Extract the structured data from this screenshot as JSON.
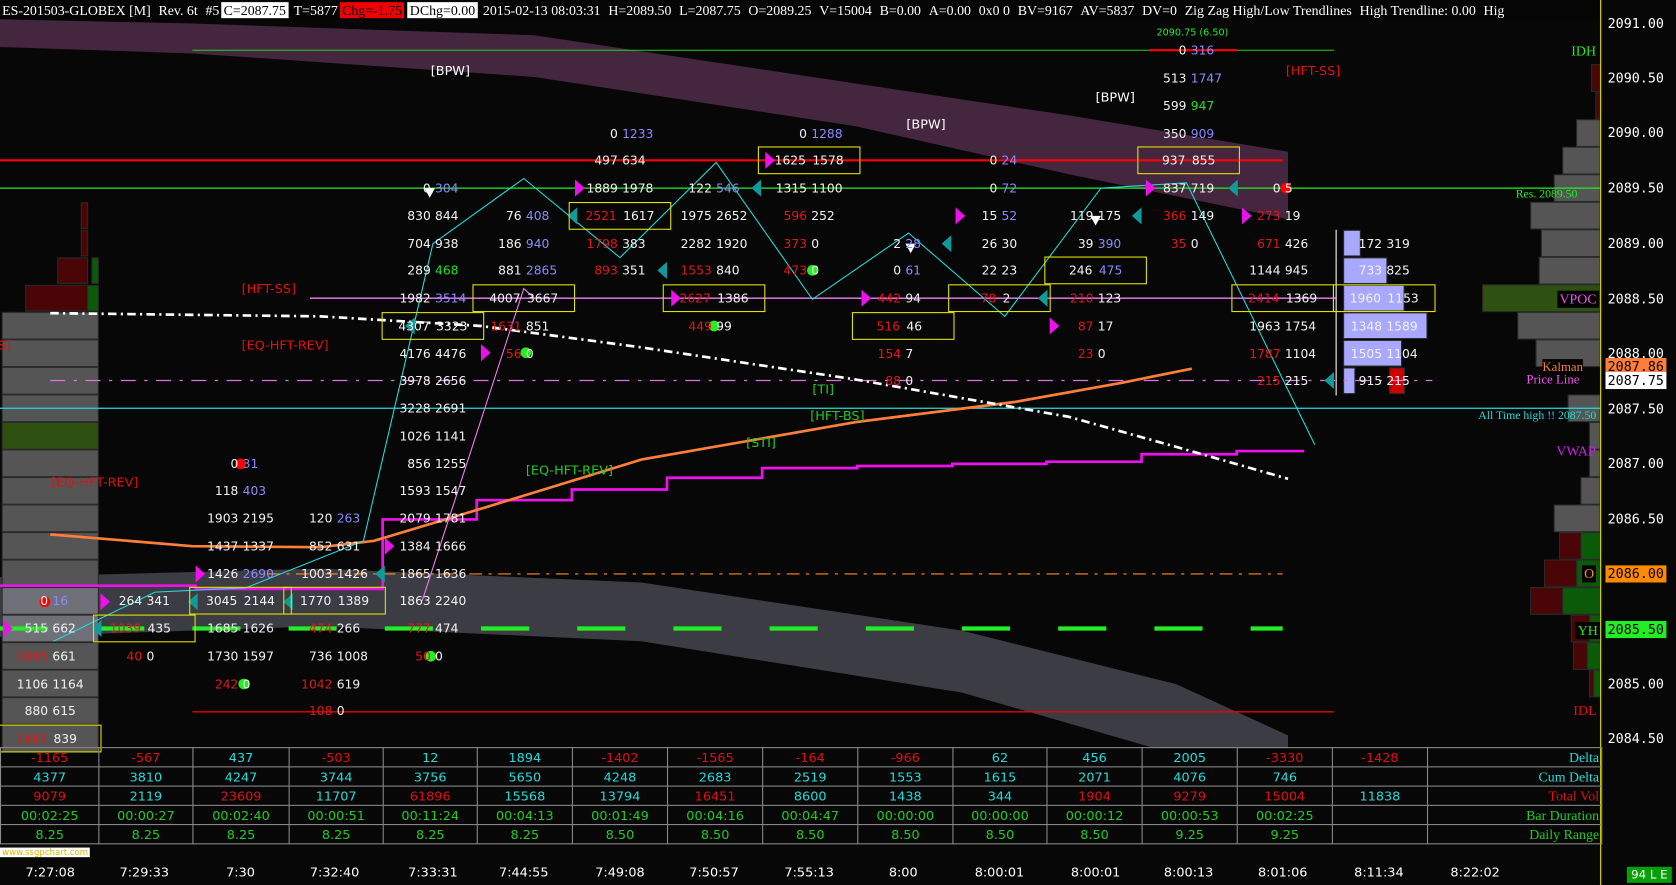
{
  "header": {
    "symbol": "ES-201503-GLOBEX [M]",
    "rev": "Rev. 6t",
    "num": "#5",
    "close": "C=2087.75",
    "ticks": "T=5877",
    "chg": "Chg=-1.75",
    "dchg": "DChg=0.00",
    "datetime": "2015-02-13 08:03:31",
    "high": "H=2089.50",
    "low": "L=2087.75",
    "open": "O=2089.25",
    "volume": "V=15004",
    "bid": "B=0.00",
    "ask": "A=0.00",
    "size": "0x0 0",
    "bv": "BV=9167",
    "av": "AV=5837",
    "dv": "DV=0",
    "study": "Zig Zag High/Low Trendlines",
    "high_trendline": "High Trendline: 0.00",
    "trunc": "Hig"
  },
  "price_axis": [
    "2091.00",
    "2090.50",
    "2090.00",
    "2089.50",
    "2089.00",
    "2088.50",
    "2088.00",
    "2087.50",
    "2087.00",
    "2086.50",
    "2086.00",
    "2085.50",
    "2085.00",
    "2084.50"
  ],
  "axis_markers": {
    "kalman_value": "2087.86",
    "price_value": "2087.75",
    "open_value": "2086.00",
    "yh_value": "2085.50"
  },
  "right_labels": {
    "idh": "IDH",
    "res": "Res.  2089.50",
    "vpoc": "VPOC",
    "kalman": "Kalman",
    "price_line": "Price Line",
    "ath": "All Time  high !!  2087.50",
    "vwap": "VWAP",
    "open": "O",
    "yh": "YH",
    "idl": "IDL",
    "ib_range": "2090.75 (6.50)"
  },
  "chart_labels": {
    "bpw1": "[BPW]",
    "bpw2": "[BPW]",
    "bpw3": "[BPW]",
    "hftss1": "[HFT-SS]",
    "hftss2": "[HFT-SS]",
    "eqhft1": "[EQ-HFT-REV]",
    "eqhft2": "[EQ-HFT-REV]",
    "eqhft3": "[EQ-HFT-REV]",
    "ti": "[TI]",
    "hftbs": "[HFT-BS]",
    "sti": "[STI]",
    "clip": "S]"
  },
  "colors": {
    "bid_red": "#e01818",
    "ask_blue": "#8a8aff",
    "ask_green": "#22e022",
    "box": "#e6e600",
    "vwap": "#ee11ee",
    "kalman": "#ff7f3a",
    "zigzag": "#22dddd"
  },
  "footprint": [
    {
      "c": 0,
      "p": 2085.75,
      "b": "0",
      "a": "16",
      "bc": "w",
      "ac": "b"
    },
    {
      "c": 0,
      "p": 2085.5,
      "b": "515",
      "a": "662",
      "bc": "w",
      "ac": "w"
    },
    {
      "c": 0,
      "p": 2085.25,
      "b": "1065",
      "a": "661",
      "bc": "r",
      "ac": "w"
    },
    {
      "c": 0,
      "p": 2085,
      "b": "1106",
      "a": "1164",
      "bc": "w",
      "ac": "w"
    },
    {
      "c": 0,
      "p": 2084.75,
      "b": "880",
      "a": "615",
      "bc": "w",
      "ac": "w"
    },
    {
      "c": 0,
      "p": 2084.5,
      "b": "1443",
      "a": "839",
      "bc": "r",
      "ac": "w",
      "x": 1
    },
    {
      "c": 1,
      "p": 2085.75,
      "b": "264",
      "a": "341",
      "bc": "w",
      "ac": "w"
    },
    {
      "c": 1,
      "p": 2085.5,
      "b": "1039",
      "a": "435",
      "bc": "r",
      "ac": "w",
      "x": 1
    },
    {
      "c": 1,
      "p": 2085.25,
      "b": "40",
      "a": "0",
      "bc": "r",
      "ac": "w"
    },
    {
      "c": 2,
      "p": 2087,
      "b": "0",
      "a": "31",
      "bc": "w",
      "ac": "b"
    },
    {
      "c": 2,
      "p": 2086.75,
      "b": "118",
      "a": "403",
      "bc": "w",
      "ac": "b"
    },
    {
      "c": 2,
      "p": 2086.5,
      "b": "1903",
      "a": "2195",
      "bc": "w",
      "ac": "w"
    },
    {
      "c": 2,
      "p": 2086.25,
      "b": "1437",
      "a": "1337",
      "bc": "w",
      "ac": "w"
    },
    {
      "c": 2,
      "p": 2086,
      "b": "1426",
      "a": "2690",
      "bc": "w",
      "ac": "b"
    },
    {
      "c": 2,
      "p": 2085.75,
      "b": "3045",
      "a": "2144",
      "bc": "w",
      "ac": "w",
      "x": 1
    },
    {
      "c": 2,
      "p": 2085.5,
      "b": "1685",
      "a": "1626",
      "bc": "w",
      "ac": "w"
    },
    {
      "c": 2,
      "p": 2085.25,
      "b": "1730",
      "a": "1597",
      "bc": "w",
      "ac": "w"
    },
    {
      "c": 2,
      "p": 2085,
      "b": "242",
      "a": "0",
      "bc": "r",
      "ac": "w"
    },
    {
      "c": 3,
      "p": 2086.5,
      "b": "120",
      "a": "263",
      "bc": "w",
      "ac": "b"
    },
    {
      "c": 3,
      "p": 2086.25,
      "b": "852",
      "a": "631",
      "bc": "w",
      "ac": "w"
    },
    {
      "c": 3,
      "p": 2086,
      "b": "1003",
      "a": "1426",
      "bc": "w",
      "ac": "w"
    },
    {
      "c": 3,
      "p": 2085.75,
      "b": "1770",
      "a": "1389",
      "bc": "w",
      "ac": "w",
      "x": 1
    },
    {
      "c": 3,
      "p": 2085.5,
      "b": "474",
      "a": "266",
      "bc": "r",
      "ac": "w"
    },
    {
      "c": 3,
      "p": 2085.25,
      "b": "736",
      "a": "1008",
      "bc": "w",
      "ac": "w"
    },
    {
      "c": 3,
      "p": 2085,
      "b": "1042",
      "a": "619",
      "bc": "r",
      "ac": "w"
    },
    {
      "c": 3,
      "p": 2084.75,
      "b": "108",
      "a": "0",
      "bc": "r",
      "ac": "w"
    },
    {
      "c": 4,
      "p": 2089.5,
      "b": "0",
      "a": "304",
      "bc": "w",
      "ac": "b"
    },
    {
      "c": 4,
      "p": 2089.25,
      "b": "830",
      "a": "844",
      "bc": "w",
      "ac": "w"
    },
    {
      "c": 4,
      "p": 2089,
      "b": "704",
      "a": "938",
      "bc": "w",
      "ac": "w"
    },
    {
      "c": 4,
      "p": 2088.75,
      "b": "289",
      "a": "468",
      "bc": "w",
      "ac": "g"
    },
    {
      "c": 4,
      "p": 2088.5,
      "b": "1982",
      "a": "3514",
      "bc": "w",
      "ac": "b"
    },
    {
      "c": 4,
      "p": 2088.25,
      "b": "4307",
      "a": "3323",
      "bc": "w",
      "ac": "w",
      "x": 1
    },
    {
      "c": 4,
      "p": 2088,
      "b": "4176",
      "a": "4476",
      "bc": "w",
      "ac": "w"
    },
    {
      "c": 4,
      "p": 2087.75,
      "b": "3978",
      "a": "2656",
      "bc": "w",
      "ac": "w"
    },
    {
      "c": 4,
      "p": 2087.5,
      "b": "3228",
      "a": "2691",
      "bc": "w",
      "ac": "w"
    },
    {
      "c": 4,
      "p": 2087.25,
      "b": "1026",
      "a": "1141",
      "bc": "w",
      "ac": "w"
    },
    {
      "c": 4,
      "p": 2087,
      "b": "856",
      "a": "1255",
      "bc": "w",
      "ac": "w"
    },
    {
      "c": 4,
      "p": 2086.75,
      "b": "1593",
      "a": "1547",
      "bc": "w",
      "ac": "w"
    },
    {
      "c": 4,
      "p": 2086.5,
      "b": "2079",
      "a": "1781",
      "bc": "w",
      "ac": "w"
    },
    {
      "c": 4,
      "p": 2086.25,
      "b": "1384",
      "a": "1666",
      "bc": "w",
      "ac": "w"
    },
    {
      "c": 4,
      "p": 2086,
      "b": "1865",
      "a": "1636",
      "bc": "w",
      "ac": "w"
    },
    {
      "c": 4,
      "p": 2085.75,
      "b": "1863",
      "a": "2240",
      "bc": "w",
      "ac": "w"
    },
    {
      "c": 4,
      "p": 2085.5,
      "b": "777",
      "a": "474",
      "bc": "r",
      "ac": "w"
    },
    {
      "c": 4,
      "p": 2085.25,
      "b": "50",
      "a": "0",
      "bc": "r",
      "ac": "w"
    },
    {
      "c": 5,
      "p": 2089.25,
      "b": "76",
      "a": "408",
      "bc": "w",
      "ac": "b"
    },
    {
      "c": 5,
      "p": 2089,
      "b": "186",
      "a": "940",
      "bc": "w",
      "ac": "b"
    },
    {
      "c": 5,
      "p": 2088.75,
      "b": "881",
      "a": "2865",
      "bc": "w",
      "ac": "b"
    },
    {
      "c": 5,
      "p": 2088.5,
      "b": "4007",
      "a": "3667",
      "bc": "w",
      "ac": "w",
      "x": 1
    },
    {
      "c": 5,
      "p": 2088.25,
      "b": "1631",
      "a": "851",
      "bc": "r",
      "ac": "w"
    },
    {
      "c": 5,
      "p": 2088,
      "b": "56",
      "a": "0",
      "bc": "r",
      "ac": "w"
    },
    {
      "c": 6,
      "p": 2090,
      "b": "0",
      "a": "1233",
      "bc": "w",
      "ac": "b"
    },
    {
      "c": 6,
      "p": 2089.75,
      "b": "497",
      "a": "634",
      "bc": "w",
      "ac": "w"
    },
    {
      "c": 6,
      "p": 2089.5,
      "b": "1889",
      "a": "1978",
      "bc": "w",
      "ac": "w"
    },
    {
      "c": 6,
      "p": 2089.25,
      "b": "2521",
      "a": "1617",
      "bc": "r",
      "ac": "w",
      "x": 1
    },
    {
      "c": 6,
      "p": 2089,
      "b": "1798",
      "a": "383",
      "bc": "r",
      "ac": "w"
    },
    {
      "c": 6,
      "p": 2088.75,
      "b": "893",
      "a": "351",
      "bc": "r",
      "ac": "w"
    },
    {
      "c": 7,
      "p": 2089.5,
      "b": "122",
      "a": "546",
      "bc": "w",
      "ac": "b"
    },
    {
      "c": 7,
      "p": 2089.25,
      "b": "1975",
      "a": "2652",
      "bc": "w",
      "ac": "w"
    },
    {
      "c": 7,
      "p": 2089,
      "b": "2282",
      "a": "1920",
      "bc": "w",
      "ac": "w"
    },
    {
      "c": 7,
      "p": 2088.75,
      "b": "1553",
      "a": "840",
      "bc": "r",
      "ac": "w"
    },
    {
      "c": 7,
      "p": 2088.5,
      "b": "2627",
      "a": "1386",
      "bc": "r",
      "ac": "w",
      "x": 1
    },
    {
      "c": 7,
      "p": 2088.25,
      "b": "449",
      "a": "99",
      "bc": "r",
      "ac": "w"
    },
    {
      "c": 8,
      "p": 2090,
      "b": "0",
      "a": "1288",
      "bc": "w",
      "ac": "b"
    },
    {
      "c": 8,
      "p": 2089.75,
      "b": "1625",
      "a": "1578",
      "bc": "w",
      "ac": "w",
      "x": 1
    },
    {
      "c": 8,
      "p": 2089.5,
      "b": "1315",
      "a": "1100",
      "bc": "w",
      "ac": "w"
    },
    {
      "c": 8,
      "p": 2089.25,
      "b": "596",
      "a": "252",
      "bc": "r",
      "ac": "w"
    },
    {
      "c": 8,
      "p": 2089,
      "b": "373",
      "a": "0",
      "bc": "r",
      "ac": "w"
    },
    {
      "c": 8,
      "p": 2088.75,
      "b": "473",
      "a": "0",
      "bc": "r",
      "ac": "w"
    },
    {
      "c": 9,
      "p": 2089,
      "b": "2",
      "a": "28",
      "bc": "w",
      "ac": "b"
    },
    {
      "c": 9,
      "p": 2088.75,
      "b": "0",
      "a": "61",
      "bc": "w",
      "ac": "b"
    },
    {
      "c": 9,
      "p": 2088.5,
      "b": "442",
      "a": "94",
      "bc": "r",
      "ac": "w"
    },
    {
      "c": 9,
      "p": 2088.25,
      "b": "516",
      "a": "46",
      "bc": "r",
      "ac": "w",
      "x": 1
    },
    {
      "c": 9,
      "p": 2088,
      "b": "154",
      "a": "7",
      "bc": "r",
      "ac": "w"
    },
    {
      "c": 9,
      "p": 2087.75,
      "b": "88",
      "a": "0",
      "bc": "r",
      "ac": "w"
    },
    {
      "c": 10,
      "p": 2089.75,
      "b": "0",
      "a": "24",
      "bc": "w",
      "ac": "b"
    },
    {
      "c": 10,
      "p": 2089.5,
      "b": "0",
      "a": "72",
      "bc": "w",
      "ac": "b"
    },
    {
      "c": 10,
      "p": 2089.25,
      "b": "15",
      "a": "52",
      "bc": "w",
      "ac": "b"
    },
    {
      "c": 10,
      "p": 2089,
      "b": "26",
      "a": "30",
      "bc": "w",
      "ac": "w"
    },
    {
      "c": 10,
      "p": 2088.75,
      "b": "22",
      "a": "23",
      "bc": "w",
      "ac": "w"
    },
    {
      "c": 10,
      "p": 2088.5,
      "b": "78",
      "a": "2",
      "bc": "r",
      "ac": "w",
      "x": 1
    },
    {
      "c": 11,
      "p": 2089.25,
      "b": "119",
      "a": "175",
      "bc": "w",
      "ac": "w"
    },
    {
      "c": 11,
      "p": 2089,
      "b": "39",
      "a": "390",
      "bc": "w",
      "ac": "b"
    },
    {
      "c": 11,
      "p": 2088.75,
      "b": "246",
      "a": "475",
      "bc": "w",
      "ac": "b",
      "x": 1
    },
    {
      "c": 11,
      "p": 2088.5,
      "b": "210",
      "a": "123",
      "bc": "r",
      "ac": "w"
    },
    {
      "c": 11,
      "p": 2088.25,
      "b": "87",
      "a": "17",
      "bc": "r",
      "ac": "w"
    },
    {
      "c": 11,
      "p": 2088,
      "b": "23",
      "a": "0",
      "bc": "r",
      "ac": "w"
    },
    {
      "c": 12,
      "p": 2090.75,
      "b": "0",
      "a": "316",
      "bc": "w",
      "ac": "b"
    },
    {
      "c": 12,
      "p": 2090.5,
      "b": "513",
      "a": "1747",
      "bc": "w",
      "ac": "b"
    },
    {
      "c": 12,
      "p": 2090.25,
      "b": "599",
      "a": "947",
      "bc": "w",
      "ac": "g"
    },
    {
      "c": 12,
      "p": 2090,
      "b": "350",
      "a": "909",
      "bc": "w",
      "ac": "b"
    },
    {
      "c": 12,
      "p": 2089.75,
      "b": "937",
      "a": "855",
      "bc": "w",
      "ac": "w",
      "x": 1
    },
    {
      "c": 12,
      "p": 2089.5,
      "b": "837",
      "a": "719",
      "bc": "w",
      "ac": "w"
    },
    {
      "c": 12,
      "p": 2089.25,
      "b": "366",
      "a": "149",
      "bc": "r",
      "ac": "w"
    },
    {
      "c": 12,
      "p": 2089,
      "b": "35",
      "a": "0",
      "bc": "r",
      "ac": "w"
    },
    {
      "c": 13,
      "p": 2089.5,
      "b": "0",
      "a": "5",
      "bc": "w",
      "ac": "w"
    },
    {
      "c": 13,
      "p": 2089.25,
      "b": "273",
      "a": "19",
      "bc": "r",
      "ac": "w"
    },
    {
      "c": 13,
      "p": 2089,
      "b": "671",
      "a": "426",
      "bc": "r",
      "ac": "w"
    },
    {
      "c": 13,
      "p": 2088.75,
      "b": "1144",
      "a": "945",
      "bc": "w",
      "ac": "w"
    },
    {
      "c": 13,
      "p": 2088.5,
      "b": "2414",
      "a": "1369",
      "bc": "r",
      "ac": "w",
      "x": 1
    },
    {
      "c": 13,
      "p": 2088.25,
      "b": "1963",
      "a": "1754",
      "bc": "w",
      "ac": "w"
    },
    {
      "c": 13,
      "p": 2088,
      "b": "1787",
      "a": "1104",
      "bc": "r",
      "ac": "w"
    },
    {
      "c": 13,
      "p": 2087.75,
      "b": "215",
      "a": "215",
      "bc": "r",
      "ac": "w"
    },
    {
      "c": 14,
      "p": 2089,
      "b": "172",
      "a": "319",
      "bc": "w",
      "ac": "w"
    },
    {
      "c": 14,
      "p": 2088.75,
      "b": "733",
      "a": "825",
      "bc": "w",
      "ac": "w"
    },
    {
      "c": 14,
      "p": 2088.5,
      "b": "1960",
      "a": "1153",
      "bc": "w",
      "ac": "w",
      "x": 1
    },
    {
      "c": 14,
      "p": 2088.25,
      "b": "1348",
      "a": "1589",
      "bc": "w",
      "ac": "w"
    },
    {
      "c": 14,
      "p": 2088,
      "b": "1505",
      "a": "1104",
      "bc": "w",
      "ac": "w"
    },
    {
      "c": 14,
      "p": 2087.75,
      "b": "915",
      "a": "215",
      "bc": "w",
      "ac": "w"
    }
  ],
  "stats": {
    "row_labels": [
      "Delta",
      "Cum Delta",
      "Total Vol",
      "Bar Duration",
      "Daily Range"
    ],
    "delta": [
      "-1165",
      "-567",
      "437",
      "-503",
      "12",
      "1894",
      "-1402",
      "-1565",
      "-164",
      "-966",
      "62",
      "456",
      "2005",
      "-3330",
      "-1428"
    ],
    "cum_delta": [
      "4377",
      "3810",
      "4247",
      "3744",
      "3756",
      "5650",
      "4248",
      "2683",
      "2519",
      "1553",
      "1615",
      "2071",
      "4076",
      "746",
      ""
    ],
    "total_vol": [
      "9079",
      "2119",
      "23609",
      "11707",
      "61896",
      "15568",
      "13794",
      "16451",
      "8600",
      "1438",
      "344",
      "1904",
      "9279",
      "15004",
      "11838"
    ],
    "total_vol_red": [
      true,
      false,
      true,
      false,
      true,
      false,
      false,
      true,
      false,
      false,
      false,
      true,
      true,
      true,
      false
    ],
    "bar_duration": [
      "00:02:25",
      "00:00:27",
      "00:02:40",
      "00:00:51",
      "00:11:24",
      "00:04:13",
      "00:01:49",
      "00:04:16",
      "00:04:47",
      "00:00:00",
      "00:00:00",
      "00:00:12",
      "00:00:53",
      "00:02:25",
      ""
    ],
    "daily_range": [
      "8.25",
      "8.25",
      "8.25",
      "8.25",
      "8.25",
      "8.25",
      "8.50",
      "8.50",
      "8.50",
      "8.50",
      "8.50",
      "8.50",
      "9.25",
      "9.25",
      ""
    ]
  },
  "time_axis": [
    "7:27:08",
    "7:29:33",
    "7:30",
    "7:32:40",
    "7:33:31",
    "7:44:55",
    "7:49:08",
    "7:50:57",
    "7:55:13",
    "8:00",
    "8:00:01",
    "8:00:01",
    "8:00:13",
    "8:01:06",
    "8:11:34",
    "8:22:02"
  ],
  "watermark": "www.ssgpchart.com",
  "status_badge": "94 L E"
}
